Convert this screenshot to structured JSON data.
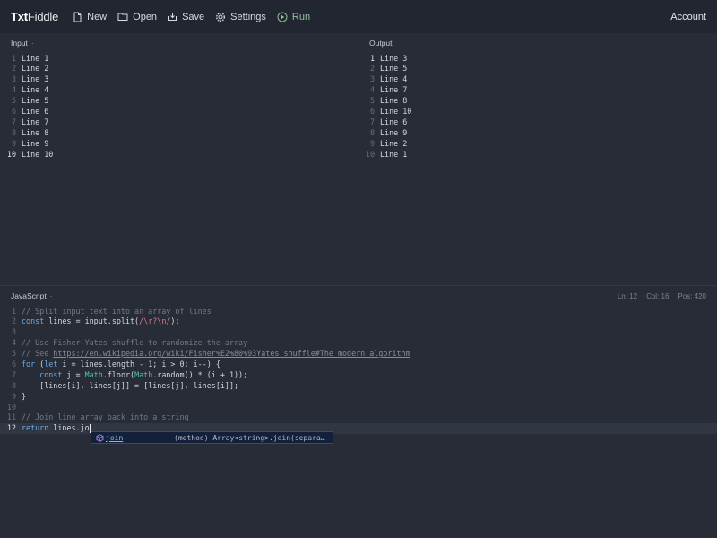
{
  "app": {
    "logo_bold": "Txt",
    "logo_rest": "Fiddle",
    "account": "Account"
  },
  "toolbar": {
    "new_label": "New",
    "open_label": "Open",
    "save_label": "Save",
    "settings_label": "Settings",
    "run_label": "Run"
  },
  "input_pane": {
    "title": "Input",
    "dot": "·",
    "lines": [
      "Line 1",
      "Line 2",
      "Line 3",
      "Line 4",
      "Line 5",
      "Line 6",
      "Line 7",
      "Line 8",
      "Line 9",
      "Line 10"
    ],
    "active_line": 10
  },
  "output_pane": {
    "title": "Output",
    "lines": [
      "Line 3",
      "Line 5",
      "Line 4",
      "Line 7",
      "Line 8",
      "Line 10",
      "Line 6",
      "Line 9",
      "Line 2",
      "Line 1"
    ],
    "active_line": 1
  },
  "js_pane": {
    "title": "JavaScript",
    "dot": "·",
    "status_ln": "Ln: 12",
    "status_col": "Col: 16",
    "status_pos": "Pos: 420",
    "line_numbers": [
      "1",
      "2",
      "3",
      "4",
      "5",
      "6",
      "7",
      "8",
      "9",
      "10",
      "11",
      "12"
    ],
    "code": {
      "l1": "// Split input text into an array of lines",
      "l2_kw": "const",
      "l2_a": " lines = input.split(",
      "l2_re": "/\\r?\\n/",
      "l2_b": ");",
      "l4": "// Use Fisher-Yates shuffle to randomize the array",
      "l5_a": "// See ",
      "l5_link": "https://en.wikipedia.org/wiki/Fisher%E2%80%93Yates_shuffle#The_modern_algorithm",
      "l6_kw1": "for",
      "l6_a": " (",
      "l6_kw2": "let",
      "l6_b": " i = lines.length - 1; i > 0; i--) {",
      "l7_ind": "    ",
      "l7_kw": "const",
      "l7_a": " j = ",
      "l7_cls1": "Math",
      "l7_b": ".floor(",
      "l7_cls2": "Math",
      "l7_c": ".random() * (i + 1));",
      "l8": "    [lines[i], lines[j]] = [lines[j], lines[i]];",
      "l9": "}",
      "l11": "// Join line array back into a string",
      "l12_kw": "return",
      "l12_a": " lines.jo"
    },
    "active_line": 12
  },
  "autocomplete": {
    "icon": "method-cube-icon",
    "name": "join",
    "detail": "(method) Array<string>.join(separa…"
  },
  "colors": {
    "background": "#282c36",
    "topbar": "#222630",
    "keyword": "#6ea8e8",
    "comment": "#737a86",
    "regex": "#d47a8a",
    "run": "#8fc29a"
  }
}
